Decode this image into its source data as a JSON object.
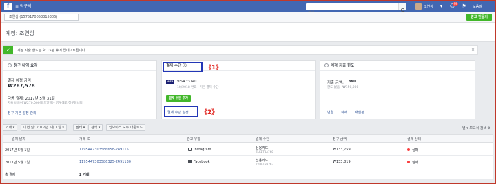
{
  "topbar": {
    "menu_label": "≡ 청구서",
    "search_placeholder": "검색",
    "user_name": "조연상",
    "badge_count": "99",
    "help_label": "도움말"
  },
  "account": {
    "selector": "조연상 (1575170053315306)",
    "create_button": "광고 만들기"
  },
  "page": {
    "title": "계정: 조연상"
  },
  "notice": {
    "text": "계정 지출 한도는 약 15분 후에 업데이트됩니다"
  },
  "billing_summary": {
    "title": "청구 내역 요약",
    "amount_label": "결제 예정 금액",
    "amount": "₩267,578",
    "next_label": "다음 결제: 2017년 5월 31일",
    "next_sub": "지출 비용이 ₩270,000에 도달하는 경우에도 청구됩니다",
    "settings_link": "청구 기본 설정 관리"
  },
  "payment_method": {
    "title": "결제 수단",
    "card_brand": "VISA",
    "card_number": "VISA *3140",
    "card_sub": "10/2018 만료 · 기본 결제 수단",
    "add_button": "결제 수단 추가",
    "settings_link": "결제 수단 설정"
  },
  "spend_limit": {
    "title": "계정 지출 한도",
    "spent_label": "지출 금액:",
    "spent_value": "₩0",
    "limit_sub": "한도 없음 · ₩150,000",
    "actions": [
      "변경",
      "삭제",
      "재설정"
    ]
  },
  "callouts": [
    "《1》",
    "《2》"
  ],
  "toolbar": {
    "buttons": [
      "거래 ▾",
      "이번 달: 2017년 5월 1일 ▾",
      "필터 ▾",
      "검색 ▾",
      "인보이스 모두 다운로드"
    ],
    "right_text": "열 ▾ 보고서 검색 ⚙"
  },
  "table": {
    "headers": [
      "결제 날짜",
      "거래 ID",
      "광고 유형",
      "결제 수단",
      "청구 금액",
      "결제 상태"
    ],
    "rows": [
      {
        "date": "2017년 5월 1일",
        "txn": "1195447303586658-2491151",
        "type": "Instagram",
        "pay": "신용카드",
        "pay_sub": "ZLKBT8A760",
        "amount": "₩133,759",
        "status": "실패"
      },
      {
        "date": "2017년 5월 1일",
        "txn": "1195447303586325-2491130",
        "type": "Facebook",
        "pay": "신용카드",
        "pay_sub": "ZKBET8A762",
        "amount": "₩133,819",
        "status": "실패"
      }
    ],
    "total_label": "총 결제",
    "total_value": "2 거래"
  },
  "colors": {
    "brand": "#4267b2",
    "success": "#42b72a",
    "callout": "#e0211b",
    "highlight": "#2337b6"
  }
}
